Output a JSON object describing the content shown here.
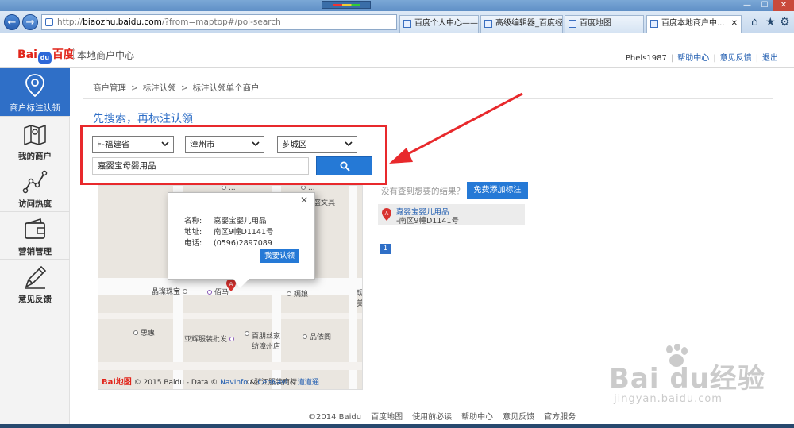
{
  "browser": {
    "address_host": "biaozhu.baidu.com",
    "address_prefix": "http://",
    "address_rest": "/?from=maptop#/poi-search",
    "tabs": [
      {
        "title": "百度个人中心——..."
      },
      {
        "title": "高级编辑器_百度经验"
      },
      {
        "title": "百度地图"
      },
      {
        "title": "百度本地商户中..."
      }
    ],
    "nav_icons": [
      "back-icon",
      "forward-icon",
      "home-icon",
      "star-icon",
      "gear-icon"
    ]
  },
  "header": {
    "logo_text_left": "Bai",
    "logo_text_mid": "du",
    "logo_text_right": "百度",
    "site_name": "本地商户中心",
    "user": "Phels1987",
    "links": [
      "帮助中心",
      "意见反馈",
      "退出"
    ]
  },
  "sidebar": {
    "items": [
      {
        "label": "商户标注认领",
        "icon": "location-pin-icon",
        "active": true
      },
      {
        "label": "我的商户",
        "icon": "map-icon"
      },
      {
        "label": "访问热度",
        "icon": "line-chart-icon"
      },
      {
        "label": "营销管理",
        "icon": "wallet-icon"
      },
      {
        "label": "意见反馈",
        "icon": "pencil-icon"
      }
    ]
  },
  "breadcrumb": [
    "商户管理",
    "标注认领",
    "标注认领单个商户"
  ],
  "page_title": "先搜索，再标注认领",
  "search": {
    "province": "F-福建省",
    "city": "漳州市",
    "district": "芗城区",
    "keyword": "嘉婴宝母婴用品"
  },
  "map": {
    "pois": [
      "...",
      "...",
      "盛文具",
      "晶璨珠宝",
      "佰马",
      "嫣娘",
      "思惠",
      "亚辉服装批发",
      "百朋丝家纺漳州店",
      "品依阁",
      "浙江服装商行",
      "现",
      "美"
    ],
    "popup": {
      "name_key": "名称:",
      "name": "嘉婴宝婴儿用品",
      "addr_key": "地址:",
      "addr": "南区9幢D1141号",
      "tel_key": "电话:",
      "tel": "(0596)2897089",
      "button": "我要认领"
    },
    "pin_letter": "A",
    "copyright": "© 2015 Baidu - Data ©",
    "navinfo": "NavInfo",
    "amp": "&",
    "cennavi": "CenNavi",
    "amp2": "&",
    "dao": "道道通",
    "logo_text": "Bai地图"
  },
  "results": {
    "no_result_text": "没有查到想要的结果？",
    "add_button": "免费添加标注",
    "items": [
      {
        "letter": "A",
        "name": "嘉婴宝婴儿用品",
        "address": "-南区9幢D1141号"
      }
    ],
    "page": "1"
  },
  "footer": [
    "©2014 Baidu",
    "百度地图",
    "使用前必读",
    "帮助中心",
    "意见反馈",
    "官方服务"
  ],
  "watermark": {
    "main": "Bai du经验",
    "sub": "jingyan.baidu.com"
  },
  "colors": {
    "brand_blue": "#2f6fc7",
    "button_blue": "#2579d6",
    "highlight_red": "#e8292c"
  }
}
